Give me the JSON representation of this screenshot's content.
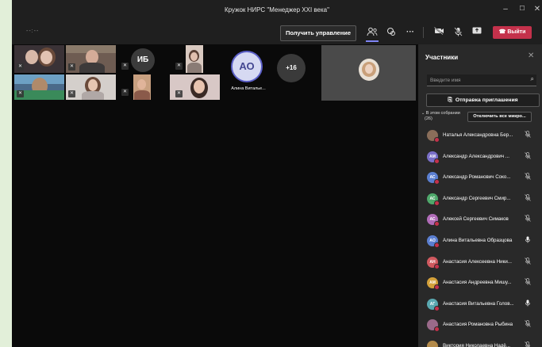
{
  "window": {
    "title": "Кружок НИРС \"Менеджер XXI века\"",
    "minimize": "–",
    "maximize": "☐",
    "close": "✕"
  },
  "toolbar": {
    "timer": "--:--",
    "control_button": "Получить управление",
    "icons": [
      "people-icon",
      "chat-icon",
      "more-icon",
      "camera-off-icon",
      "mic-off-icon",
      "share-icon"
    ],
    "leave_button": "Выйти"
  },
  "stage": {
    "avatar_ib": "ИБ",
    "avatar_ao": "АО",
    "ao_name": "Алина Виталье...",
    "more_count": "+16"
  },
  "panel": {
    "title": "Участники",
    "search_placeholder": "Введите имя",
    "invite_button": "Отправка приглашения",
    "in_meeting_label": "В этом собрании",
    "in_meeting_count": "(26)",
    "mute_all_button": "Отключить все микро...",
    "participants": [
      {
        "initials": "",
        "name": "Наталья Александровна Бер...",
        "color": "#8a6e5a",
        "photo": true,
        "mic": "muted"
      },
      {
        "initials": "АМ",
        "name": "Александр Александрович ...",
        "color": "#7a6fc8",
        "photo": false,
        "mic": "muted"
      },
      {
        "initials": "АС",
        "name": "Александр Романович Соко...",
        "color": "#5b7fd1",
        "photo": false,
        "mic": "muted"
      },
      {
        "initials": "АС",
        "name": "Александр Сергеевич Смир...",
        "color": "#4fa86b",
        "photo": false,
        "mic": "muted"
      },
      {
        "initials": "АС",
        "name": "Алексей Сергеевич Симаков",
        "color": "#b06cb8",
        "photo": false,
        "mic": "muted"
      },
      {
        "initials": "АО",
        "name": "Алина Витальевна Образцова",
        "color": "#5b7fd1",
        "photo": false,
        "mic": "on"
      },
      {
        "initials": "АН",
        "name": "Анастасия Алексеевна Ники...",
        "color": "#d0595f",
        "photo": false,
        "mic": "muted"
      },
      {
        "initials": "АМ",
        "name": "Анастасия Андреевна Мишу...",
        "color": "#d4a13a",
        "photo": false,
        "mic": "muted"
      },
      {
        "initials": "АГ",
        "name": "Анастасия Витальевна Голов...",
        "color": "#5aa8b0",
        "photo": false,
        "mic": "on"
      },
      {
        "initials": "",
        "name": "Анастасия Романовна Рыбина",
        "color": "#9a6a8a",
        "photo": true,
        "mic": "muted"
      },
      {
        "initials": "",
        "name": "Виктория Николаевна Надё...",
        "color": "#b38a4a",
        "photo": true,
        "mic": "muted"
      }
    ]
  }
}
